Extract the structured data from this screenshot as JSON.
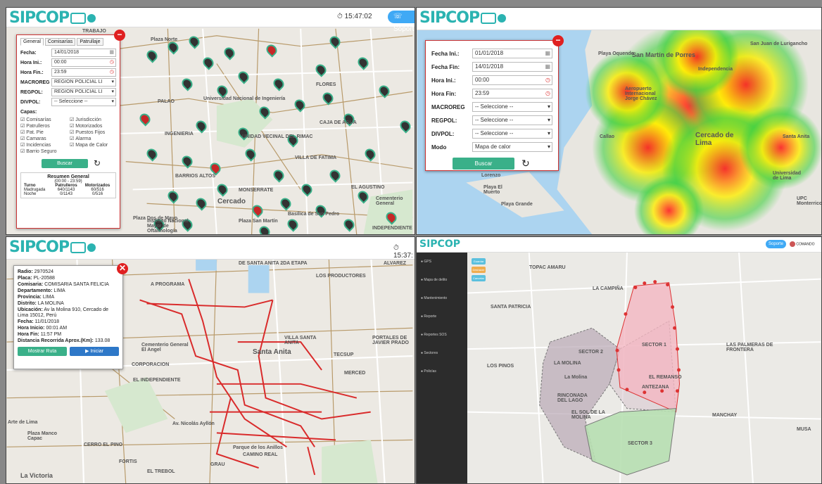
{
  "brand": {
    "logo_text": "SIPCOP",
    "accent": "#2bb3b1"
  },
  "pane1": {
    "clock": "15:47:02",
    "support_label": "Soporte",
    "tabs": [
      "General",
      "Comisarías",
      "Patrullaje"
    ],
    "fields": [
      {
        "label": "Fecha:",
        "value": "14/01/2018"
      },
      {
        "label": "Hora Ini.:",
        "value": "00:00"
      },
      {
        "label": "Hora Fin.:",
        "value": "23:59"
      },
      {
        "label": "MACROREG",
        "value": "REGION POLICIAL LI"
      },
      {
        "label": "REGPOL:",
        "value": "REGION POLICIAL LI"
      },
      {
        "label": "DIVPOL:",
        "value": "-- Seleccione --"
      }
    ],
    "layers_title": "Capas:",
    "layers": [
      "Comisarías",
      "Jurisdicción",
      "Patrulleros",
      "Motorizados",
      "Pat. Pie",
      "Puestos Fijos",
      "Camaras",
      "Alarma",
      "Incidencias",
      "Mapa de Calor",
      "Barrio Seguro"
    ],
    "search_label": "Buscar",
    "summary": {
      "title": "Resumen General",
      "range": "(00:00 - 23:59)",
      "headers": [
        "Turno",
        "Patrulleros",
        "Motorizados"
      ],
      "rows": [
        [
          "Madrugada",
          "640/1143",
          "60/516"
        ],
        [
          "Noche",
          "0/1143",
          "0/516"
        ]
      ]
    },
    "map_labels": [
      "Universidad Nacional de Ingeniería",
      "FLORES",
      "INGENIERIA",
      "UNIDAD VECINAL DEL RIMAC",
      "CAJA DE AGUA",
      "VILLA DE FATIMA",
      "BARRIOS ALTOS",
      "MONSERRATE",
      "EL AGUSTINO",
      "Cercado",
      "TRABAJO",
      "Plaza Norte",
      "Basílica de San Pedro",
      "Plaza San Martín",
      "Instituto Nacional Mayor de Oftalmología",
      "INDEPENDIENTE",
      "Cementerio General",
      "PALAO",
      "Plaza Dos de Mayo"
    ]
  },
  "pane2": {
    "fields": [
      {
        "label": "Fecha Ini.:",
        "value": "01/01/2018"
      },
      {
        "label": "Fecha Fin:",
        "value": "14/01/2018"
      },
      {
        "label": "Hora Ini.:",
        "value": "00:00"
      },
      {
        "label": "Hora Fin:",
        "value": "23:59"
      },
      {
        "label": "MACROREG",
        "value": "-- Seleccione --"
      },
      {
        "label": "REGPOL:",
        "value": "-- Seleccione --"
      },
      {
        "label": "DIVPOL:",
        "value": "-- Seleccione --"
      },
      {
        "label": "Modo",
        "value": "Mapa de calor"
      }
    ],
    "search_label": "Buscar",
    "map_labels": [
      "San Juan de Lurigancho",
      "San Martín de Porres",
      "Aeropuerto Internacional Jorge Chávez",
      "Playa Oquendo",
      "Cercado de Lima",
      "Callao",
      "Playa El Muerto",
      "Playa Grande",
      "Lorenzo",
      "Santa Anita",
      "Universidad de Lima",
      "UPC Monterrico",
      "Independencia"
    ]
  },
  "pane3": {
    "clock": "15:37:",
    "info": [
      {
        "k": "Radio:",
        "v": "2970524"
      },
      {
        "k": "Placa:",
        "v": "PL-20588"
      },
      {
        "k": "Comisaria:",
        "v": "COMISARIA SANTA FELICIA"
      },
      {
        "k": "Departamento:",
        "v": "LIMA"
      },
      {
        "k": "Provincia:",
        "v": "LIMA"
      },
      {
        "k": "Distrito:",
        "v": "LA MOLINA"
      },
      {
        "k": "Ubicación:",
        "v": "Av la Molina 910, Cercado de Lima 15012, Perú"
      },
      {
        "k": "Fecha:",
        "v": "11/01/2018"
      },
      {
        "k": "Hora Inicio:",
        "v": "00:01 AM"
      },
      {
        "k": "Hora Fin:",
        "v": "11:57 PM"
      },
      {
        "k": "Distancia Recorrida Aprox.(Km):",
        "v": "133.08"
      }
    ],
    "show_route_label": "Mostrar Ruta",
    "start_label": "▶ Iniciar",
    "map_labels": [
      "DE SANTA ANITA 2DA ETAPA",
      "LOS PRODUCTORES",
      "Santa Anita",
      "VILLA SANTA ANITA",
      "PORTALES DE JAVIER PRADO",
      "Cementerio General El Angel",
      "EL INDEPENDIENTE",
      "CORPORACION",
      "MERCED",
      "Plaza Manco Capac",
      "CERRO EL PINO",
      "FORTIS",
      "EL TREBOL",
      "GRAU",
      "La Victoria",
      "CAMINO REAL",
      "Av. Nicolás Ayllón",
      "Parque de los Anillos",
      "A PROGRAMA",
      "TECSUP",
      "ALVAREZ",
      "Arte de Lima"
    ]
  },
  "pane4": {
    "brand": "SIPCOP",
    "support_label": "Soporte",
    "user_label": "COMANDO",
    "sidebar": [
      "GPS",
      "Mapa de delito",
      "Mantenimiento",
      "Reporte",
      "Reportes SOS",
      "Sectores",
      "Policías"
    ],
    "chips": [
      {
        "label": "Guardar",
        "color": "#5bc0de"
      },
      {
        "label": "Deshacer",
        "color": "#f0ad4e"
      },
      {
        "label": "Cancelar",
        "color": "#5bc0de"
      }
    ],
    "map_labels": [
      "LA MOLINA",
      "La Molina",
      "EL REMANSO",
      "ANTEZANA",
      "LOS PINOS",
      "SANTA PATRICIA",
      "RINCONADA DEL LAGO",
      "SECTOR 1",
      "SECTOR 2",
      "SECTOR 3",
      "EL SOL DE LA MOLINA",
      "LA CAMPIÑA",
      "TOPAC AMARU",
      "LAS PALMERAS DE FRONTERA",
      "MANCHAY",
      "MUSA"
    ]
  },
  "colors": {
    "danger": "#e02020",
    "button_green": "#3ab089",
    "route": "#d92b2b",
    "sidebar": "#2c2c2c"
  }
}
